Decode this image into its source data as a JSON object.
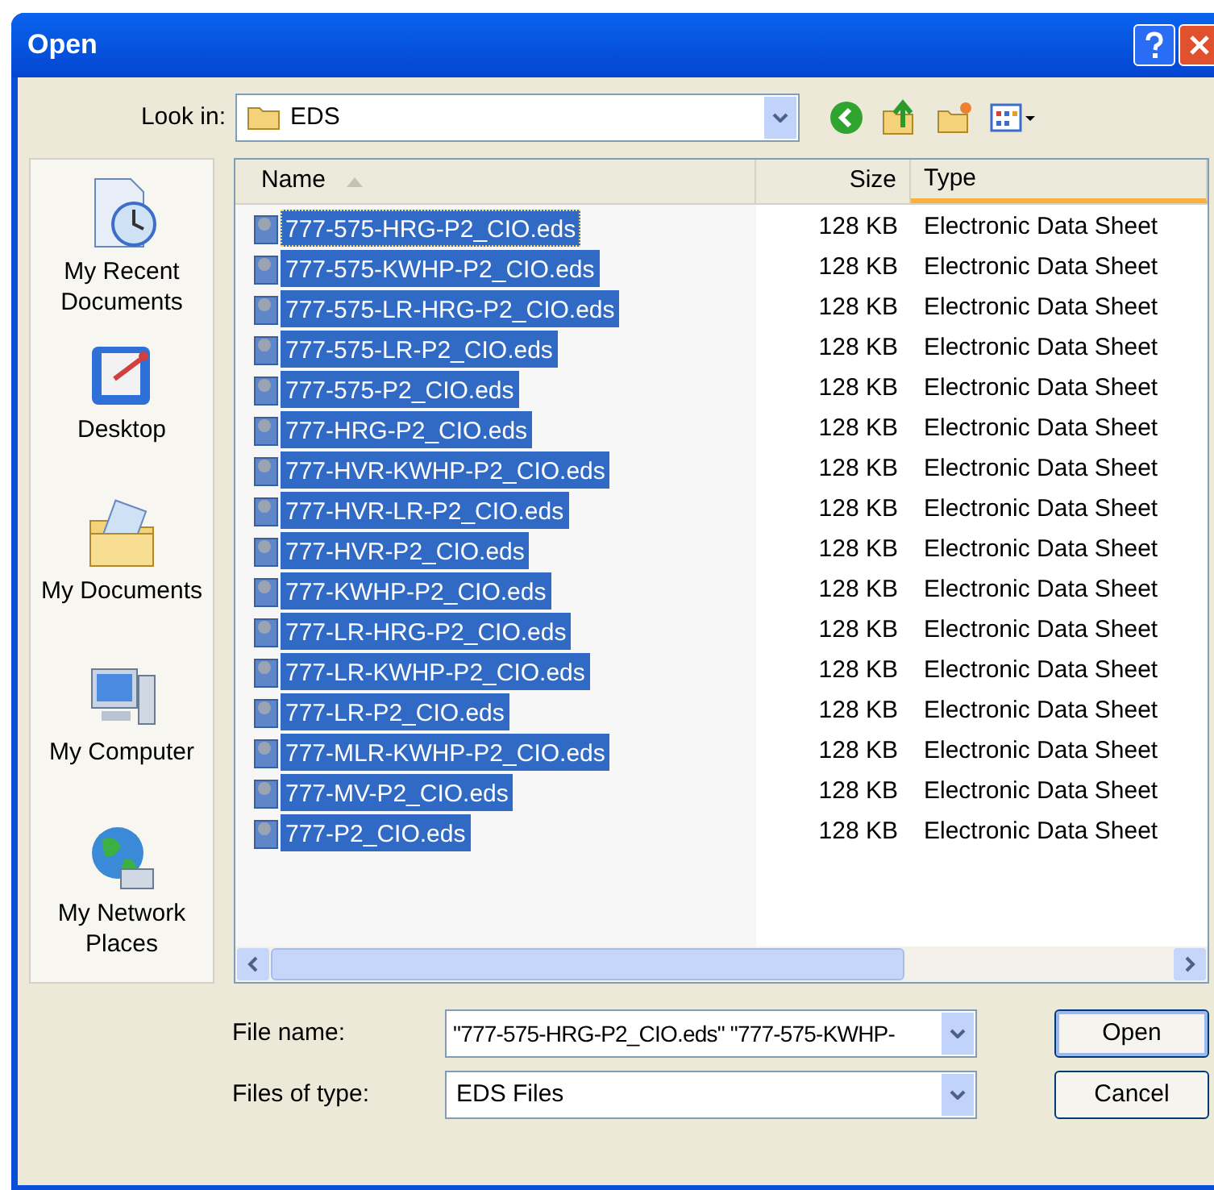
{
  "window": {
    "title": "Open"
  },
  "look_in": {
    "label": "Look in:",
    "value": "EDS"
  },
  "places": [
    {
      "label": "My Recent Documents",
      "kind": "recent"
    },
    {
      "label": "Desktop",
      "kind": "desktop"
    },
    {
      "label": "My Documents",
      "kind": "documents"
    },
    {
      "label": "My Computer",
      "kind": "computer"
    },
    {
      "label": "My Network Places",
      "kind": "network"
    }
  ],
  "file_list": {
    "columns": [
      {
        "label": "Name",
        "sorted": true,
        "hover": false
      },
      {
        "label": "Size",
        "sorted": false,
        "hover": false
      },
      {
        "label": "Type",
        "sorted": false,
        "hover": true
      }
    ],
    "rows": [
      {
        "name": "777-575-HRG-P2_CIO.eds",
        "size": "128 KB",
        "type": "Electronic Data Sheet",
        "selected": true,
        "focused": true
      },
      {
        "name": "777-575-KWHP-P2_CIO.eds",
        "size": "128 KB",
        "type": "Electronic Data Sheet",
        "selected": true,
        "focused": false
      },
      {
        "name": "777-575-LR-HRG-P2_CIO.eds",
        "size": "128 KB",
        "type": "Electronic Data Sheet",
        "selected": true,
        "focused": false
      },
      {
        "name": "777-575-LR-P2_CIO.eds",
        "size": "128 KB",
        "type": "Electronic Data Sheet",
        "selected": true,
        "focused": false
      },
      {
        "name": "777-575-P2_CIO.eds",
        "size": "128 KB",
        "type": "Electronic Data Sheet",
        "selected": true,
        "focused": false
      },
      {
        "name": "777-HRG-P2_CIO.eds",
        "size": "128 KB",
        "type": "Electronic Data Sheet",
        "selected": true,
        "focused": false
      },
      {
        "name": "777-HVR-KWHP-P2_CIO.eds",
        "size": "128 KB",
        "type": "Electronic Data Sheet",
        "selected": true,
        "focused": false
      },
      {
        "name": "777-HVR-LR-P2_CIO.eds",
        "size": "128 KB",
        "type": "Electronic Data Sheet",
        "selected": true,
        "focused": false
      },
      {
        "name": "777-HVR-P2_CIO.eds",
        "size": "128 KB",
        "type": "Electronic Data Sheet",
        "selected": true,
        "focused": false
      },
      {
        "name": "777-KWHP-P2_CIO.eds",
        "size": "128 KB",
        "type": "Electronic Data Sheet",
        "selected": true,
        "focused": false
      },
      {
        "name": "777-LR-HRG-P2_CIO.eds",
        "size": "128 KB",
        "type": "Electronic Data Sheet",
        "selected": true,
        "focused": false
      },
      {
        "name": "777-LR-KWHP-P2_CIO.eds",
        "size": "128 KB",
        "type": "Electronic Data Sheet",
        "selected": true,
        "focused": false
      },
      {
        "name": "777-LR-P2_CIO.eds",
        "size": "128 KB",
        "type": "Electronic Data Sheet",
        "selected": true,
        "focused": false
      },
      {
        "name": "777-MLR-KWHP-P2_CIO.eds",
        "size": "128 KB",
        "type": "Electronic Data Sheet",
        "selected": true,
        "focused": false
      },
      {
        "name": "777-MV-P2_CIO.eds",
        "size": "128 KB",
        "type": "Electronic Data Sheet",
        "selected": true,
        "focused": false
      },
      {
        "name": "777-P2_CIO.eds",
        "size": "128 KB",
        "type": "Electronic Data Sheet",
        "selected": true,
        "focused": false
      }
    ]
  },
  "file_name": {
    "label": "File name:",
    "value": "\"777-575-HRG-P2_CIO.eds\" \"777-575-KWHP-"
  },
  "file_type": {
    "label": "Files of type:",
    "value": "EDS Files"
  },
  "buttons": [
    {
      "label": "Open",
      "default": true
    },
    {
      "label": "Cancel",
      "default": false
    }
  ]
}
